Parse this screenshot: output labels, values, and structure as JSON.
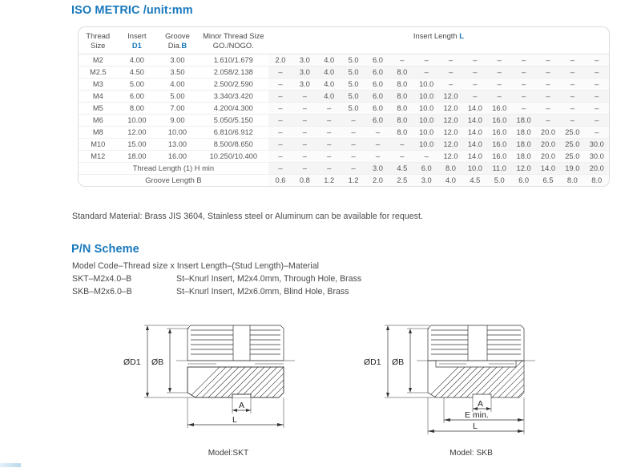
{
  "sections": {
    "iso_heading": "ISO METRIC /unit:mm",
    "pn_heading": "P/N Scheme"
  },
  "table": {
    "headers": {
      "thread_size": "Thread\nSize",
      "thread_size_l1": "Thread",
      "thread_size_l2": "Size",
      "insert_l1": "Insert",
      "insert_l2": "D1",
      "groove_l1": "Groove",
      "groove_l2a": "Dia.",
      "groove_l2b": "B",
      "minor_l1": "Minor Thread Size",
      "minor_l2": "GO./NOGO.",
      "insert_length_a": "Insert  Length  ",
      "insert_length_b": "L"
    },
    "rows": [
      {
        "thread": "M2",
        "d1": "4.00",
        "b": "3.00",
        "minor": "1.610/1.679",
        "lengths": [
          "2.0",
          "3.0",
          "4.0",
          "5.0",
          "6.0",
          "–",
          "–",
          "–",
          "–",
          "–",
          "–",
          "–",
          "–",
          "–"
        ]
      },
      {
        "thread": "M2.5",
        "d1": "4.50",
        "b": "3.50",
        "minor": "2.058/2.138",
        "lengths": [
          "–",
          "3.0",
          "4.0",
          "5.0",
          "6.0",
          "8.0",
          "–",
          "–",
          "–",
          "–",
          "–",
          "–",
          "–",
          "–"
        ]
      },
      {
        "thread": "M3",
        "d1": "5.00",
        "b": "4.00",
        "minor": "2.500/2.590",
        "lengths": [
          "–",
          "3.0",
          "4.0",
          "5.0",
          "6.0",
          "8.0",
          "10.0",
          "–",
          "–",
          "–",
          "–",
          "–",
          "–",
          "–"
        ]
      },
      {
        "thread": "M4",
        "d1": "6.00",
        "b": "5.00",
        "minor": "3.340/3.420",
        "lengths": [
          "–",
          "–",
          "4.0",
          "5.0",
          "6.0",
          "8.0",
          "10.0",
          "12.0",
          "–",
          "–",
          "–",
          "–",
          "–",
          "–"
        ]
      },
      {
        "thread": "M5",
        "d1": "8.00",
        "b": "7.00",
        "minor": "4.200/4.300",
        "lengths": [
          "–",
          "–",
          "–",
          "5.0",
          "6.0",
          "8.0",
          "10.0",
          "12.0",
          "14.0",
          "16.0",
          "–",
          "–",
          "–",
          "–"
        ]
      },
      {
        "thread": "M6",
        "d1": "10.00",
        "b": "9.00",
        "minor": "5.050/5.150",
        "lengths": [
          "–",
          "–",
          "–",
          "–",
          "6.0",
          "8.0",
          "10.0",
          "12.0",
          "14.0",
          "16.0",
          "18.0",
          "–",
          "–",
          "–"
        ]
      },
      {
        "thread": "M8",
        "d1": "12.00",
        "b": "10.00",
        "minor": "6.810/6.912",
        "lengths": [
          "–",
          "–",
          "–",
          "–",
          "–",
          "8.0",
          "10.0",
          "12.0",
          "14.0",
          "16.0",
          "18.0",
          "20.0",
          "25.0",
          "–"
        ]
      },
      {
        "thread": "M10",
        "d1": "15.00",
        "b": "13.00",
        "minor": "8.500/8.650",
        "lengths": [
          "–",
          "–",
          "–",
          "–",
          "–",
          "–",
          "10.0",
          "12.0",
          "14.0",
          "16.0",
          "18.0",
          "20.0",
          "25.0",
          "30.0"
        ]
      },
      {
        "thread": "M12",
        "d1": "18.00",
        "b": "16.00",
        "minor": "10.250/10.400",
        "lengths": [
          "–",
          "–",
          "–",
          "–",
          "–",
          "–",
          "–",
          "12.0",
          "14.0",
          "16.0",
          "18.0",
          "20.0",
          "25.0",
          "30.0"
        ]
      }
    ],
    "footer_rows": [
      {
        "label": "Thread Length (1) H min",
        "lengths": [
          "–",
          "–",
          "–",
          "–",
          "3.0",
          "4.5",
          "6.0",
          "8.0",
          "10.0",
          "11.0",
          "12.0",
          "14.0",
          "19.0",
          "20.0"
        ]
      },
      {
        "label": "Groove Length B",
        "lengths": [
          "0.6",
          "0.8",
          "1.2",
          "1.2",
          "2.0",
          "2.5",
          "3.0",
          "4.0",
          "4.5",
          "5.0",
          "6.0",
          "6.5",
          "8.0",
          "8.0"
        ]
      }
    ]
  },
  "material_note": "Standard Material: Brass JIS 3604, Stainless steel or Aluminum can be available for request.",
  "pn": {
    "format": "Model Code–Thread size x Insert Length–(Stud Length)–Material",
    "examples": [
      {
        "code": "SKT–M2x4.0–B",
        "description": "St–Knurl Insert, M2x4.0mm, Through Hole, Brass"
      },
      {
        "code": "SKB–M2x6.0–B",
        "description": "St–Knurl Insert, M2x6.0mm, Blind Hole, Brass"
      }
    ]
  },
  "drawings": {
    "skt": {
      "caption": "Model:SKT",
      "dim_d1": "ØD1",
      "dim_b": "ØB",
      "dim_a": "A",
      "dim_l": "L"
    },
    "skb": {
      "caption": "Model: SKB",
      "dim_d1": "ØD1",
      "dim_b": "ØB",
      "dim_a": "A",
      "dim_e": "E min.",
      "dim_l": "L"
    }
  },
  "colors": {
    "heading_blue": "#1878bd",
    "body_gray": "#4a4a4a",
    "line_gray": "#333333"
  }
}
